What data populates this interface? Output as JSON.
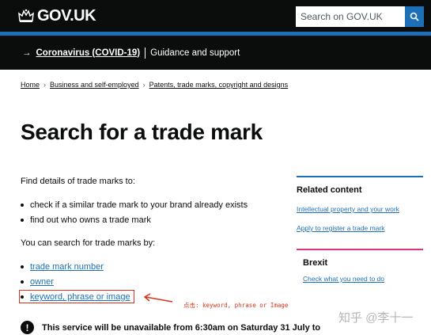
{
  "header": {
    "logo_text": "GOV.UK",
    "search_placeholder": "Search on GOV.UK",
    "colors": {
      "black": "#0b0c0c",
      "blue": "#1d70b8"
    }
  },
  "covid_banner": {
    "arrow": "→",
    "link_text": "Coronavirus (COVID-19)",
    "text": "Guidance and support"
  },
  "breadcrumb": {
    "items": [
      "Home",
      "Business and self-employed",
      "Patents, trade marks, copyright and designs"
    ],
    "separator": "›"
  },
  "page": {
    "title": "Search for a trade mark",
    "intro": "Find details of trade marks to:",
    "purposes": [
      "check if a similar trade mark to your brand already exists",
      "find out who owns a trade mark"
    ],
    "search_by_intro": "You can search for trade marks by:",
    "search_by_links": [
      "trade mark number",
      "owner",
      "keyword, phrase or image"
    ],
    "notice_icon": "!",
    "notice_text": "This service will be unavailable from 6:30am on Saturday 31 July to"
  },
  "annotation": {
    "text": "点击: keyword, phrase or Image",
    "color": "#d4351c"
  },
  "sidebar": {
    "related_heading": "Related content",
    "related_links": [
      "Intellectual property and your work",
      "Apply to register a trade mark"
    ],
    "brexit_heading": "Brexit",
    "brexit_link": "Check what you need to do",
    "brexit_color": "#d53880"
  },
  "watermark": "知乎 @李十一"
}
